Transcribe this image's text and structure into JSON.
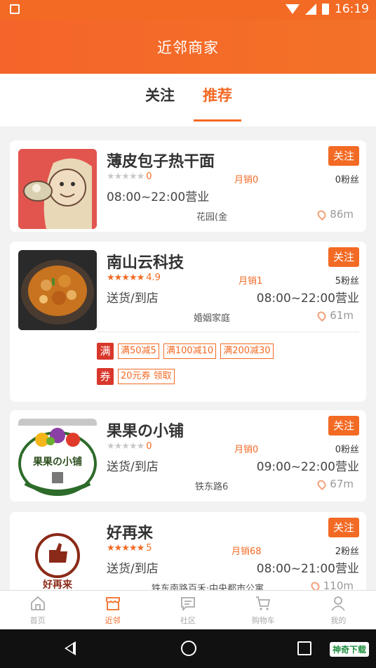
{
  "status_bar": {
    "time": "16:19"
  },
  "app_bar": {
    "title": "近邻商家"
  },
  "tabs": [
    {
      "label": "关注"
    },
    {
      "label": "推荐"
    }
  ],
  "shops": [
    {
      "name": "薄皮包子热干面",
      "follow_label": "关注",
      "stars_filled": 0,
      "rating": "0",
      "sales": "月销0",
      "fans": "0粉丝",
      "line2_left": "08:00~22:00营业",
      "line2_right": "",
      "address": "花园(金",
      "distance": "86m"
    },
    {
      "name": "南山云科技",
      "follow_label": "关注",
      "stars_filled": 5,
      "rating": "4.9",
      "sales": "月销1",
      "fans": "5粉丝",
      "line2_left": "送货/到店",
      "line2_right": "08:00~22:00营业",
      "address": "婚姻家庭",
      "distance": "61m",
      "promo": {
        "full_tag": "满",
        "full_items": [
          "满50减5",
          "满100减10",
          "满200减30"
        ],
        "coupon_tag": "券",
        "coupon_items": [
          "20元券 领取"
        ]
      }
    },
    {
      "name": "果果の小铺",
      "follow_label": "关注",
      "stars_filled": 0,
      "rating": "0",
      "sales": "月销0",
      "fans": "0粉丝",
      "line2_left": "送货/到店",
      "line2_right": "09:00~22:00营业",
      "address": "铁东路6",
      "distance": "67m",
      "logo_text": "果果の小铺"
    },
    {
      "name": "好再来",
      "follow_label": "关注",
      "stars_filled": 5,
      "rating": "5",
      "sales": "月销68",
      "fans": "2粉丝",
      "line2_left": "送货/到店",
      "line2_right": "08:00~21:00营业",
      "address": "铁东南路百禾·中央都市公寓",
      "distance": "110m",
      "logo_text": "好再来"
    }
  ],
  "bottom_nav": [
    {
      "label": "首页",
      "icon": "home-icon"
    },
    {
      "label": "近邻",
      "icon": "store-icon"
    },
    {
      "label": "社区",
      "icon": "chat-icon"
    },
    {
      "label": "购物车",
      "icon": "cart-icon"
    },
    {
      "label": "我的",
      "icon": "person-icon"
    }
  ],
  "watermark": "神奇下载",
  "colors": {
    "accent": "#f36a24",
    "promo_red": "#d9372b"
  }
}
